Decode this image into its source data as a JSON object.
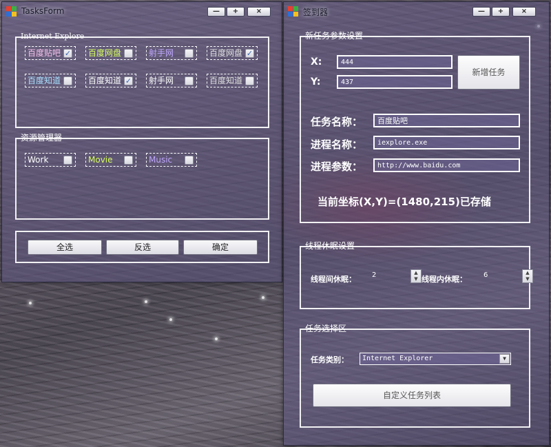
{
  "colors": {
    "window_bg": "#5f5680",
    "pink_label": "#f6c0ec",
    "yellow_label": "#d8ff60",
    "purple_label": "#c0a8ff",
    "blue_label": "#a8e0ff",
    "gray_label": "#e0e0e0"
  },
  "tasks_form": {
    "title": "TasksForm",
    "window_buttons": {
      "minimize": "—",
      "maximize": "+",
      "close": "×"
    },
    "ie_group": {
      "legend": "Internet Explore",
      "items": [
        {
          "label": "百度贴吧",
          "checked": true,
          "color": "#f6c0ec"
        },
        {
          "label": "百度网盘",
          "checked": false,
          "color": "#d8ff60"
        },
        {
          "label": "射手网",
          "checked": false,
          "color": "#c0a8ff"
        },
        {
          "label": "百度网盘",
          "checked": true,
          "color": "#e0e0e0"
        },
        {
          "label": "百度知道",
          "checked": false,
          "color": "#a8e0ff"
        },
        {
          "label": "百度知道",
          "checked": true,
          "color": "#ffffff"
        },
        {
          "label": "射手网",
          "checked": false,
          "color": "#ffffff"
        },
        {
          "label": "百度知道",
          "checked": false,
          "color": "#e0e0e0"
        }
      ]
    },
    "explorer_group": {
      "legend": "资源管理器",
      "items": [
        {
          "label": "Work",
          "checked": false,
          "color": "#ffffff"
        },
        {
          "label": "Movie",
          "checked": false,
          "color": "#d8ff60"
        },
        {
          "label": "Music",
          "checked": false,
          "color": "#c0a8ff"
        }
      ]
    },
    "buttons": {
      "select_all": "全选",
      "invert": "反选",
      "confirm": "确定"
    }
  },
  "signin_form": {
    "title": "签到器",
    "window_buttons": {
      "minimize": "—",
      "maximize": "+",
      "close": "×"
    },
    "new_task_group": {
      "legend": "新任务参数设置",
      "x_label": "X:",
      "x_value": "444",
      "y_label": "Y:",
      "y_value": "437",
      "add_button": "新增任务",
      "task_name_label": "任务名称：",
      "task_name_value": "百度贴吧",
      "process_name_label": "进程名称：",
      "process_name_value": "iexplore.exe",
      "process_args_label": "进程参数：",
      "process_args_value": "http://www.baidu.com",
      "status_text": "当前坐标(X,Y)=(1480,215)已存储"
    },
    "sleep_group": {
      "legend": "线程休眠设置",
      "between_label": "线程间休眠：",
      "between_value": "2",
      "within_label": "线程内休眠：",
      "within_value": "6"
    },
    "task_select_group": {
      "legend": "任务选择区",
      "category_label": "任务类别：",
      "category_value": "Internet Explorer",
      "custom_list_button": "自定义任务列表"
    }
  }
}
